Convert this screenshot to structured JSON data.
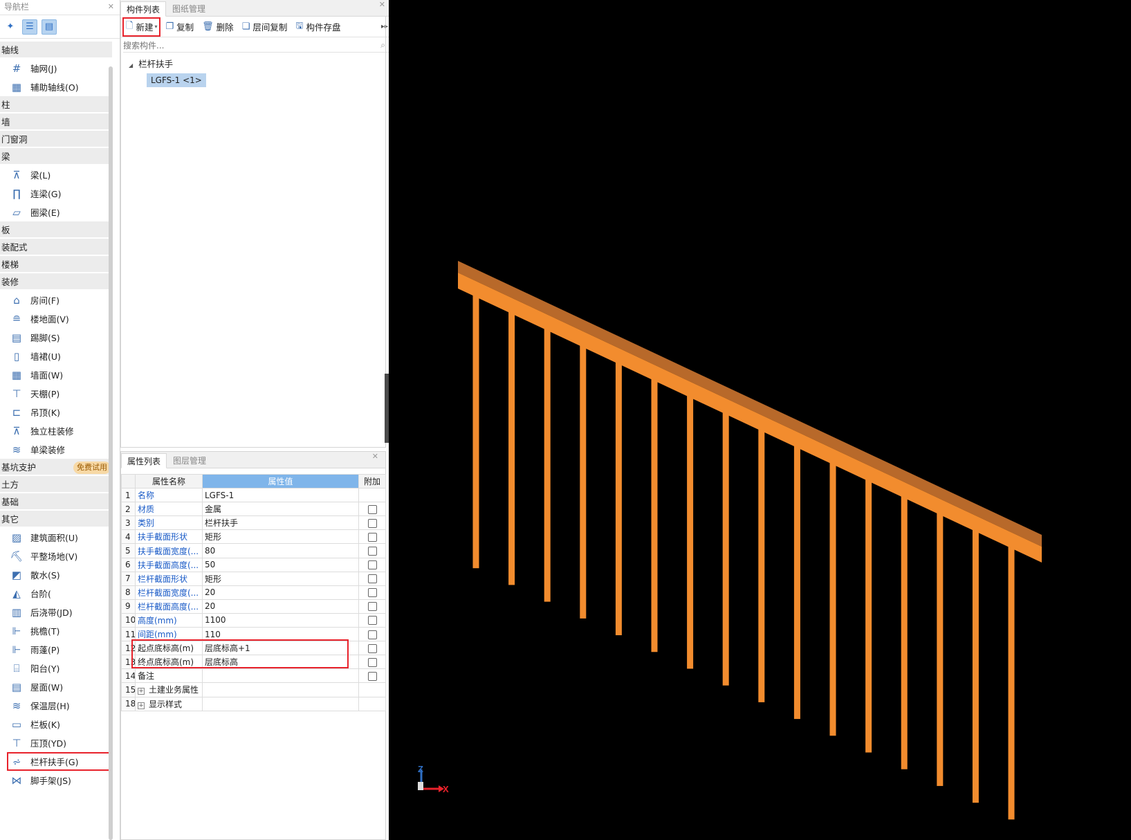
{
  "nav": {
    "title": "导航栏",
    "categories": [
      {
        "label": "轴线",
        "items": [
          {
            "label": "轴网(J)",
            "icon": "grid-axis-icon"
          },
          {
            "label": "辅助轴线(O)",
            "icon": "aux-axis-icon"
          }
        ]
      },
      {
        "label": "柱",
        "items": []
      },
      {
        "label": "墙",
        "items": []
      },
      {
        "label": "门窗洞",
        "items": []
      },
      {
        "label": "梁",
        "items": [
          {
            "label": "梁(L)",
            "icon": "beam-icon"
          },
          {
            "label": "连梁(G)",
            "icon": "link-beam-icon"
          },
          {
            "label": "圈梁(E)",
            "icon": "ring-beam-icon"
          }
        ]
      },
      {
        "label": "板",
        "items": []
      },
      {
        "label": "装配式",
        "items": []
      },
      {
        "label": "楼梯",
        "items": []
      },
      {
        "label": "装修",
        "items": [
          {
            "label": "房间(F)",
            "icon": "room-icon"
          },
          {
            "label": "楼地面(V)",
            "icon": "floor-icon"
          },
          {
            "label": "踢脚(S)",
            "icon": "skirting-icon"
          },
          {
            "label": "墙裙(U)",
            "icon": "dado-icon"
          },
          {
            "label": "墙面(W)",
            "icon": "wall-surface-icon"
          },
          {
            "label": "天棚(P)",
            "icon": "ceiling-icon"
          },
          {
            "label": "吊顶(K)",
            "icon": "suspended-ceiling-icon"
          },
          {
            "label": "独立柱装修",
            "icon": "column-finish-icon"
          },
          {
            "label": "单梁装修",
            "icon": "beam-finish-icon"
          }
        ]
      },
      {
        "label": "基坑支护",
        "badge": "免费试用",
        "items": []
      },
      {
        "label": "土方",
        "items": []
      },
      {
        "label": "基础",
        "items": []
      },
      {
        "label": "其它",
        "items": [
          {
            "label": "建筑面积(U)",
            "icon": "building-area-icon"
          },
          {
            "label": "平整场地(V)",
            "icon": "site-leveling-icon"
          },
          {
            "label": "散水(S)",
            "icon": "apron-icon"
          },
          {
            "label": "台阶(",
            "icon": "steps-icon"
          },
          {
            "label": "后浇带(JD)",
            "icon": "post-cast-strip-icon"
          },
          {
            "label": "挑檐(T)",
            "icon": "eave-icon"
          },
          {
            "label": "雨蓬(P)",
            "icon": "canopy-icon"
          },
          {
            "label": "阳台(Y)",
            "icon": "balcony-icon"
          },
          {
            "label": "屋面(W)",
            "icon": "roof-icon"
          },
          {
            "label": "保温层(H)",
            "icon": "insulation-icon"
          },
          {
            "label": "栏板(K)",
            "icon": "parapet-icon"
          },
          {
            "label": "压顶(YD)",
            "icon": "coping-icon"
          },
          {
            "label": "栏杆扶手(G)",
            "icon": "railing-icon",
            "highlighted": true
          },
          {
            "label": "脚手架(JS)",
            "icon": "scaffold-icon"
          }
        ]
      }
    ]
  },
  "component_panel": {
    "tabs": [
      "构件列表",
      "图纸管理"
    ],
    "toolbar": {
      "new": "新建",
      "copy": "复制",
      "delete": "删除",
      "floor_copy": "层间复制",
      "save": "构件存盘"
    },
    "search_placeholder": "搜索构件...",
    "tree": {
      "group": "栏杆扶手",
      "leaf": "LGFS-1 <1>"
    }
  },
  "property_panel": {
    "tabs": [
      "属性列表",
      "图层管理"
    ],
    "headers": {
      "name": "属性名称",
      "value": "属性值",
      "extra": "附加"
    },
    "rows": [
      {
        "n": "1",
        "name": "名称",
        "value": "LGFS-1",
        "blue": true,
        "check": false
      },
      {
        "n": "2",
        "name": "材质",
        "value": "金属",
        "blue": true,
        "check": true
      },
      {
        "n": "3",
        "name": "类别",
        "value": "栏杆扶手",
        "blue": true,
        "check": true
      },
      {
        "n": "4",
        "name": "扶手截面形状",
        "value": "矩形",
        "blue": true,
        "check": true
      },
      {
        "n": "5",
        "name": "扶手截面宽度(...",
        "value": "80",
        "blue": true,
        "check": true
      },
      {
        "n": "6",
        "name": "扶手截面高度(...",
        "value": "50",
        "blue": true,
        "check": true
      },
      {
        "n": "7",
        "name": "栏杆截面形状",
        "value": "矩形",
        "blue": true,
        "check": true
      },
      {
        "n": "8",
        "name": "栏杆截面宽度(...",
        "value": "20",
        "blue": true,
        "check": true
      },
      {
        "n": "9",
        "name": "栏杆截面高度(...",
        "value": "20",
        "blue": true,
        "check": true
      },
      {
        "n": "10",
        "name": "高度(mm)",
        "value": "1100",
        "blue": true,
        "check": true
      },
      {
        "n": "11",
        "name": "间距(mm)",
        "value": "110",
        "blue": true,
        "check": true
      },
      {
        "n": "12",
        "name": "起点底标高(m)",
        "value": "层底标高+1",
        "blue": false,
        "check": true,
        "selected": true
      },
      {
        "n": "13",
        "name": "终点底标高(m)",
        "value": "层底标高",
        "blue": false,
        "check": true
      },
      {
        "n": "14",
        "name": "备注",
        "value": "",
        "blue": false,
        "check": true
      },
      {
        "n": "15",
        "name": "土建业务属性",
        "value": "",
        "blue": false,
        "check": false,
        "expand": true
      },
      {
        "n": "18",
        "name": "显示样式",
        "value": "",
        "blue": false,
        "check": false,
        "expand": true
      }
    ]
  },
  "view3d": {
    "background": "#000000",
    "rail_top_color": "#b8692a",
    "rail_front_color": "#f28c2e",
    "baluster_color": "#f28c2e",
    "baluster_count": 16,
    "axis_labels": {
      "x": "X",
      "z": "Z"
    },
    "axis_colors": {
      "x": "#e8222b",
      "z": "#2f6fc4"
    }
  }
}
